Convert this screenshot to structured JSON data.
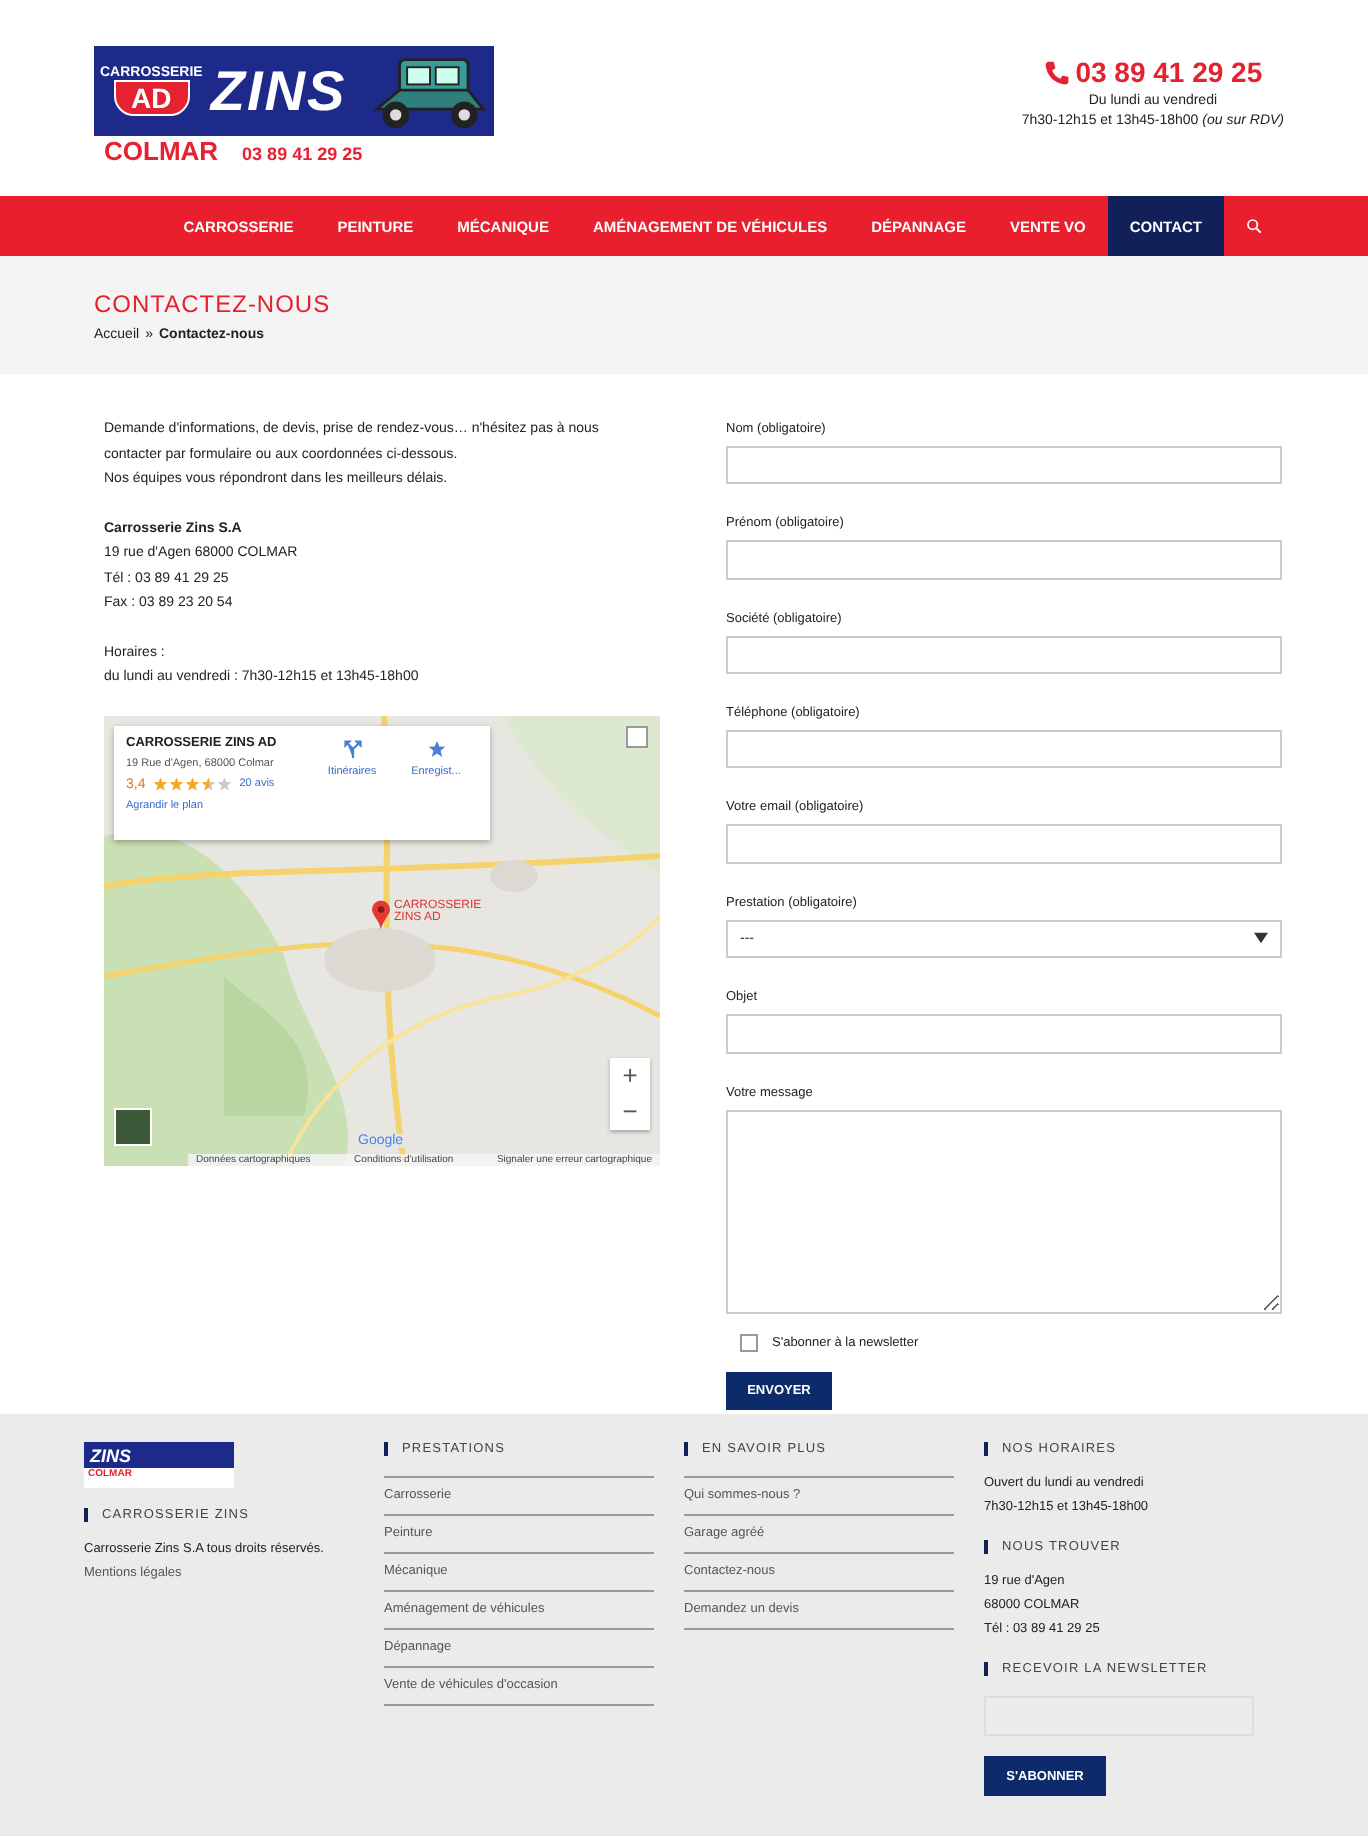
{
  "header": {
    "logo": {
      "top": "CARROSSERIE",
      "badge": "AD",
      "name": "ZINS",
      "city": "COLMAR",
      "phone": "03 89 41 29 25"
    },
    "contact": {
      "phone": "03 89 41 29 25",
      "days": "Du lundi au vendredi",
      "hours": "7h30-12h15 et 13h45-18h00 *(ou sur RDV)*"
    }
  },
  "nav": {
    "items": [
      {
        "label": "CARROSSERIE",
        "selected": false
      },
      {
        "label": "PEINTURE",
        "selected": false
      },
      {
        "label": "MÉCANIQUE",
        "selected": false
      },
      {
        "label": "AMÉNAGEMENT DE VÉHICULES",
        "selected": false
      },
      {
        "label": "DÉPANNAGE",
        "selected": false
      },
      {
        "label": "VENTE VO",
        "selected": false
      },
      {
        "label": "CONTACT",
        "selected": true
      }
    ]
  },
  "page_title": "CONTACTEZ-NOUS",
  "breadcrumb": {
    "home": "Accueil",
    "separator": "»",
    "current": "Contactez-nous"
  },
  "intro": [
    "Demande d'informations, de devis, prise de rendez-vous… n'hésitez pas à nous contacter par formulaire ou aux coordonnées ci-dessous.",
    "Nos équipes vous répondront dans les meilleurs délais."
  ],
  "company": {
    "name": "Carrosserie Zins  S.A",
    "lines": [
      "19 rue d'Agen 68000 COLMAR",
      "Tél : 03 89 41 29 25",
      "Fax : 03 89 23 20 54"
    ]
  },
  "hours": {
    "title": "Horaires :",
    "line": "du lundi au vendredi : 7h30-12h15 et 13h45-18h00"
  },
  "map": {
    "title": "CARROSSERIE ZINS AD",
    "address": "19 Rue d'Agen, 68000 Colmar",
    "rating": "3,4",
    "stars": 3.5,
    "reviews": "20 avis",
    "enlarge": "Agrandir le plan",
    "actions": [
      "Itinéraires",
      "Enregist..."
    ],
    "marker_label": "CARROSSERIE ZINS AD",
    "zoom_in": "+",
    "zoom_out": "−",
    "google": "Google",
    "attribution": [
      "Données cartographiques",
      "Conditions d'utilisation",
      "Signaler une erreur cartographique"
    ]
  },
  "form": {
    "fields": [
      {
        "label": "Nom (obligatoire)",
        "kind": "input"
      },
      {
        "label": "Prénom (obligatoire)",
        "kind": "input"
      },
      {
        "label": "Société (obligatoire)",
        "kind": "input"
      },
      {
        "label": "Téléphone (obligatoire)",
        "kind": "input"
      },
      {
        "label": "Votre email (obligatoire)",
        "kind": "input"
      },
      {
        "label": "Prestation (obligatoire)",
        "kind": "select",
        "value": "---"
      },
      {
        "label": "Objet",
        "kind": "input"
      },
      {
        "label": "Votre message",
        "kind": "textarea"
      }
    ],
    "newsletter": {
      "label": "S'abonner à la newsletter",
      "checked": false
    },
    "submit": "ENVOYER"
  },
  "footer": {
    "logo": {
      "name": "ZINS",
      "city": "COLMAR"
    },
    "about": {
      "heading": "CARROSSERIE ZINS",
      "text": "Carrosserie Zins S.A tous droits réservés.",
      "link": "Mentions légales"
    },
    "prestations": {
      "heading": "PRESTATIONS",
      "links": [
        "Carrosserie",
        "Peinture",
        "Mécanique",
        "Aménagement de véhicules",
        "Dépannage",
        "Vente de véhicules d'occasion"
      ]
    },
    "savoir": {
      "heading": "EN SAVOIR PLUS",
      "links": [
        "Qui sommes-nous ?",
        "Garage agréé",
        "Contactez-nous",
        "Demandez un devis"
      ]
    },
    "horaires": {
      "heading": "NOS HORAIRES",
      "lines": [
        "Ouvert du lundi au vendredi",
        "7h30-12h15 et 13h45-18h00"
      ]
    },
    "trouver": {
      "heading": "NOUS TROUVER",
      "lines": [
        "19 rue d'Agen",
        "68000 COLMAR",
        "Tél : 03 89 41 29 25"
      ]
    },
    "newsletter": {
      "heading": "RECEVOIR LA NEWSLETTER",
      "button": "S'ABONNER"
    }
  }
}
